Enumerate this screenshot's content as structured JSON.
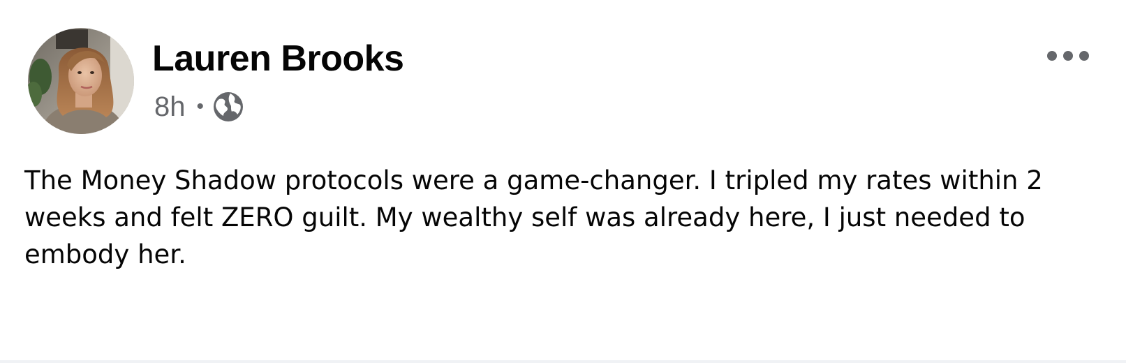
{
  "post": {
    "author": {
      "name": "Lauren Brooks",
      "avatar_icon": "profile-photo"
    },
    "meta": {
      "time": "8h",
      "separator": "•",
      "audience_icon": "globe-icon"
    },
    "menu_icon": "more-options-icon",
    "text": "The Money Shadow protocols were a game-changer. I tripled my rates within 2 weeks and felt ZERO guilt. My wealthy self was already here, I just needed to embody her."
  },
  "colors": {
    "text_primary": "#050505",
    "text_secondary": "#65676b",
    "background": "#ffffff"
  }
}
